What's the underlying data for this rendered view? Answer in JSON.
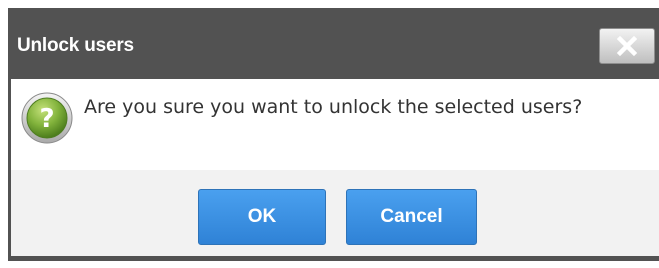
{
  "dialog": {
    "title": "Unlock users",
    "close_icon": "close-icon",
    "message": "Are you sure you want to unlock the selected users?",
    "message_icon": "help-icon",
    "buttons": {
      "ok_label": "OK",
      "cancel_label": "Cancel"
    }
  },
  "colors": {
    "titlebar_bg": "#525252",
    "primary_button": "#3b8fe3",
    "footer_bg": "#f2f2f2",
    "icon_green": "#7fb83a"
  }
}
